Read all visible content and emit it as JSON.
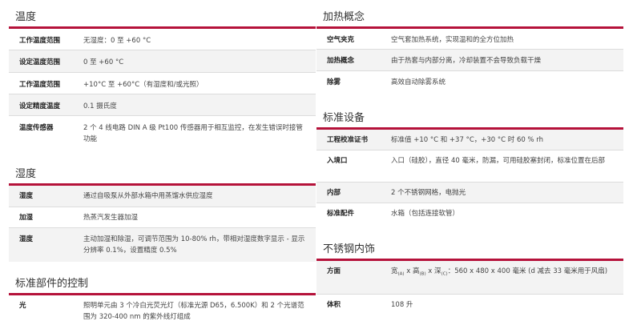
{
  "left": {
    "temp": {
      "title": "温度",
      "rows": [
        {
          "k": "工作温度范围",
          "v": "无湿度：0 至 +60 °C"
        },
        {
          "k": "设定温度范围",
          "v": "0 至 +60 °C"
        },
        {
          "k": "工作温度范围",
          "v": "+10°C 至 +60°C（有湿度和/或光照）"
        },
        {
          "k": "设定精度温度",
          "v": "0.1 摄氏度"
        },
        {
          "k": "温度传感器",
          "v": "2 个 4 线电路 DIN A 级 Pt100 传感器用于相互监控，在发生错误时接管功能"
        }
      ]
    },
    "humid": {
      "title": "湿度",
      "rows": [
        {
          "k": "湿度",
          "v": "通过自吸泵从外部水箱中用蒸馏水供应湿度"
        },
        {
          "k": "加湿",
          "v": "热蒸汽发生器加湿"
        },
        {
          "k": "湿度",
          "v": "主动加湿和除湿，可调节范围为 10-80% rh，带相对湿度数字显示 - 显示分辨率 0.1%，设置精度 0.5%"
        }
      ]
    },
    "ctrl": {
      "title": "标准部件的控制",
      "rows": [
        {
          "k": "光",
          "v": "照明单元由 3 个冷白光荧光灯（标准光源 D65，6.500K）和 2 个光谱范围为 320-400 nm 的紫外线灯组成"
        }
      ]
    }
  },
  "right": {
    "heat": {
      "title": "加热概念",
      "rows": [
        {
          "k": "空气夹克",
          "v": "空气套加热系统，实现温和的全方位加热"
        },
        {
          "k": "加热概念",
          "v": "由于热套与内部分离，冷却装置不会导致负载干燥"
        },
        {
          "k": "除雾",
          "v": "高效自动除雾系统"
        }
      ]
    },
    "equip": {
      "title": "标准设备",
      "rows": [
        {
          "k": "工程校准证书",
          "v": "标准值 +10 °C 和 +37 °C，+30 °C 时 60 % rh"
        },
        {
          "k": "入境口",
          "v": "入口（硅胶），直径 40 毫米，防漏，可用硅胶塞封闭，标准位置在后部"
        },
        {
          "k": "内部",
          "v": "2 个不锈钢网格，电抛光"
        },
        {
          "k": "标准配件",
          "v": "水箱（包括连接软管）"
        }
      ]
    },
    "steel": {
      "title": "不锈钢内饰",
      "dims_key": "方面",
      "dims": {
        "w": "宽",
        "w_sub": "(A)",
        "x1": " x ",
        "h": "高",
        "h_sub": "(B)",
        "x2": " x ",
        "d": "深",
        "d_sub": "(C)",
        "rest": "：560 x 480 x 400 毫米 (d 减去 33 毫米用于风扇)"
      },
      "vol_key": "体积",
      "vol": "108 升"
    }
  }
}
